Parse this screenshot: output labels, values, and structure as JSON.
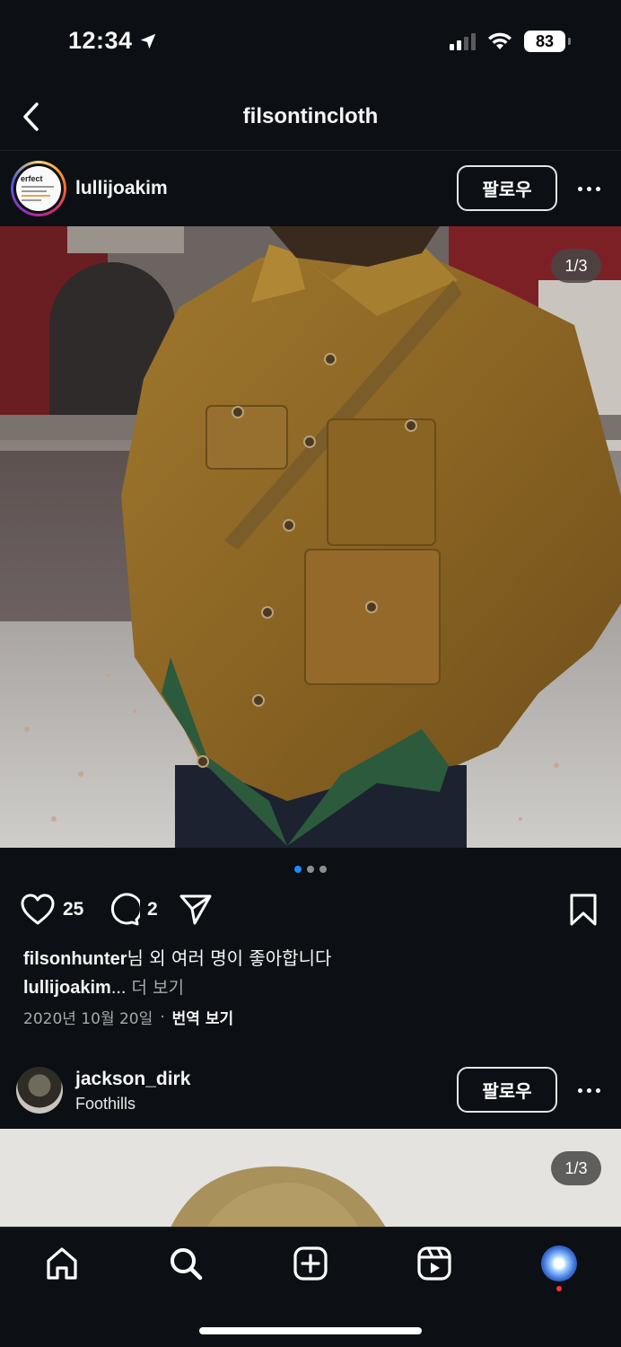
{
  "status_bar": {
    "time": "12:34",
    "battery": "83"
  },
  "header": {
    "title": "filsontincloth"
  },
  "post1": {
    "username": "lullijoakim",
    "follow_label": "팔로우",
    "counter": "1/3",
    "like_count": "25",
    "comment_count": "2",
    "likes_user": "filsonhunter",
    "likes_suffix": "님 외 여러 명이 좋아합니다",
    "caption_user": "lullijoakim",
    "caption_ellipsis": "...",
    "caption_more": " 더 보기",
    "date": "2020년 10월 20일",
    "separator": "·",
    "translate": "번역 보기",
    "carousel_pages": 3,
    "carousel_active": 1
  },
  "post2": {
    "username": "jackson_dirk",
    "location": "Foothills",
    "follow_label": "팔로우",
    "counter": "1/3"
  },
  "icons": {
    "back": "chevron-left-icon",
    "location": "location-arrow-icon",
    "like": "heart-icon",
    "comment": "comment-icon",
    "share": "paper-plane-icon",
    "save": "bookmark-icon",
    "more": "more-horizontal-icon",
    "home": "home-icon",
    "search": "search-icon",
    "create": "plus-square-icon",
    "reels": "reels-icon"
  },
  "colors": {
    "background": "#0c1014",
    "active_dot": "#1d8cf8",
    "notification": "#ff3040"
  }
}
